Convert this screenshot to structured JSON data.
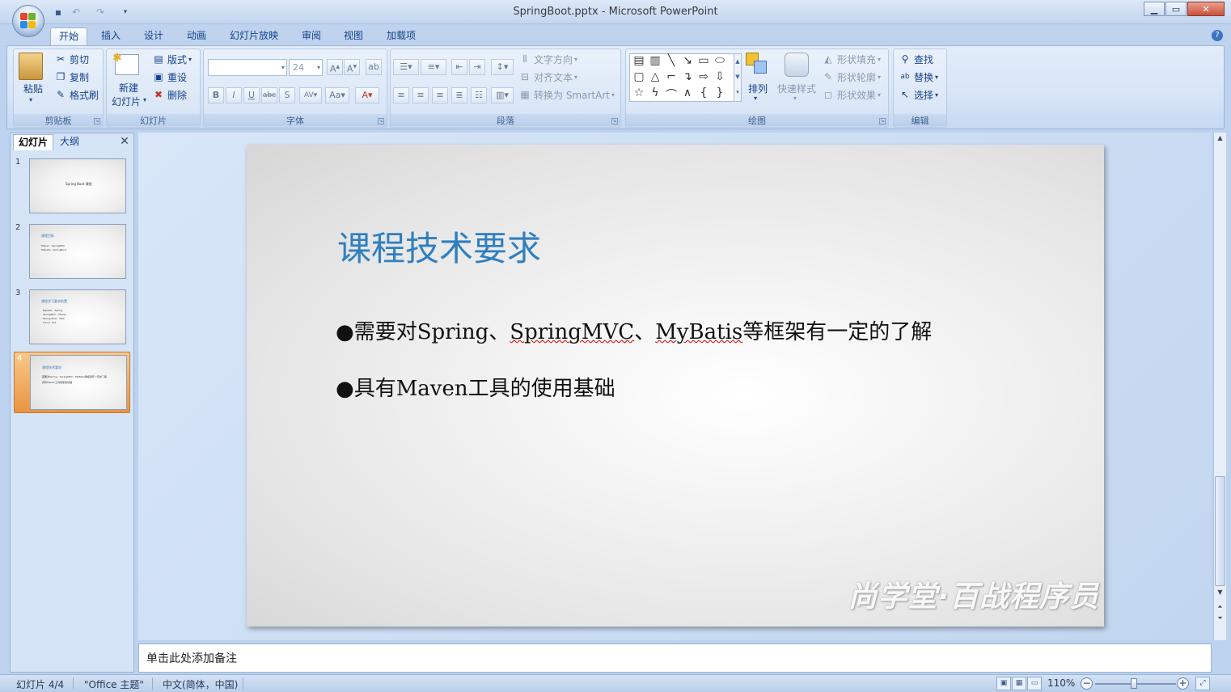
{
  "window": {
    "title": "SpringBoot.pptx - Microsoft PowerPoint"
  },
  "qat": {
    "save_icon": "save-icon",
    "undo_icon": "undo-icon",
    "redo_icon": "redo-icon",
    "customize_icon": "chevron-down-icon"
  },
  "ribbon_tabs": [
    "开始",
    "插入",
    "设计",
    "动画",
    "幻灯片放映",
    "审阅",
    "视图",
    "加载项"
  ],
  "clipboard": {
    "paste": "粘贴",
    "cut": "剪切",
    "copy": "复制",
    "format_painter": "格式刷",
    "label": "剪贴板"
  },
  "slides_group": {
    "new_slide_1": "新建",
    "new_slide_2": "幻灯片",
    "layout": "版式",
    "reset": "重设",
    "delete": "删除",
    "label": "幻灯片"
  },
  "font_group": {
    "font_size": "24",
    "label": "字体"
  },
  "paragraph_group": {
    "text_direction": "文字方向",
    "align_text": "对齐文本",
    "smartart": "转换为 SmartArt",
    "label": "段落"
  },
  "drawing_group": {
    "arrange": "排列",
    "quick_styles": "快速样式",
    "shape_fill": "形状填充",
    "shape_outline": "形状轮廓",
    "shape_effects": "形状效果",
    "label": "绘图"
  },
  "editing_group": {
    "find": "查找",
    "replace": "替换",
    "select": "选择",
    "label": "编辑"
  },
  "pane": {
    "tab_slides": "幻灯片",
    "tab_outline": "大纲",
    "close": "✕"
  },
  "thumbnails": [
    {
      "num": "1",
      "title": "Spring Boot 课程",
      "lines": []
    },
    {
      "num": "2",
      "title": "课程目标",
      "lines": [
        "Maven · SpringMVC",
        "Mybatis · SpringBoot"
      ]
    },
    {
      "num": "3",
      "title": "课程学习要求前置",
      "lines": [
        "· Mybatis · Spring",
        "· SpringMVC · Maven",
        "· Spring Boot · Web",
        "· Cloud · Ext"
      ]
    },
    {
      "num": "4",
      "title": "课程技术要求",
      "lines": [
        "需要对Spring、SpringMVC、MyBatis等框架有一定的了解",
        "具有Maven工具的使用基础"
      ]
    }
  ],
  "slide": {
    "title": "课程技术要求",
    "bullet1_a": "需要对Spring、",
    "bullet1_b": "SpringMVC",
    "bullet1_c": "、",
    "bullet1_d": "MyBatis",
    "bullet1_e": "等框架有一定的了解",
    "bullet2": "具有Maven工具的使用基础",
    "bullet_char": "●",
    "watermark": "尚学堂·百战程序员"
  },
  "notes": {
    "placeholder": "单击此处添加备注"
  },
  "status": {
    "slide_pos": "幻灯片 4/4",
    "theme": "\"Office 主题\"",
    "language": "中文(简体，中国)",
    "zoom": "110%"
  }
}
